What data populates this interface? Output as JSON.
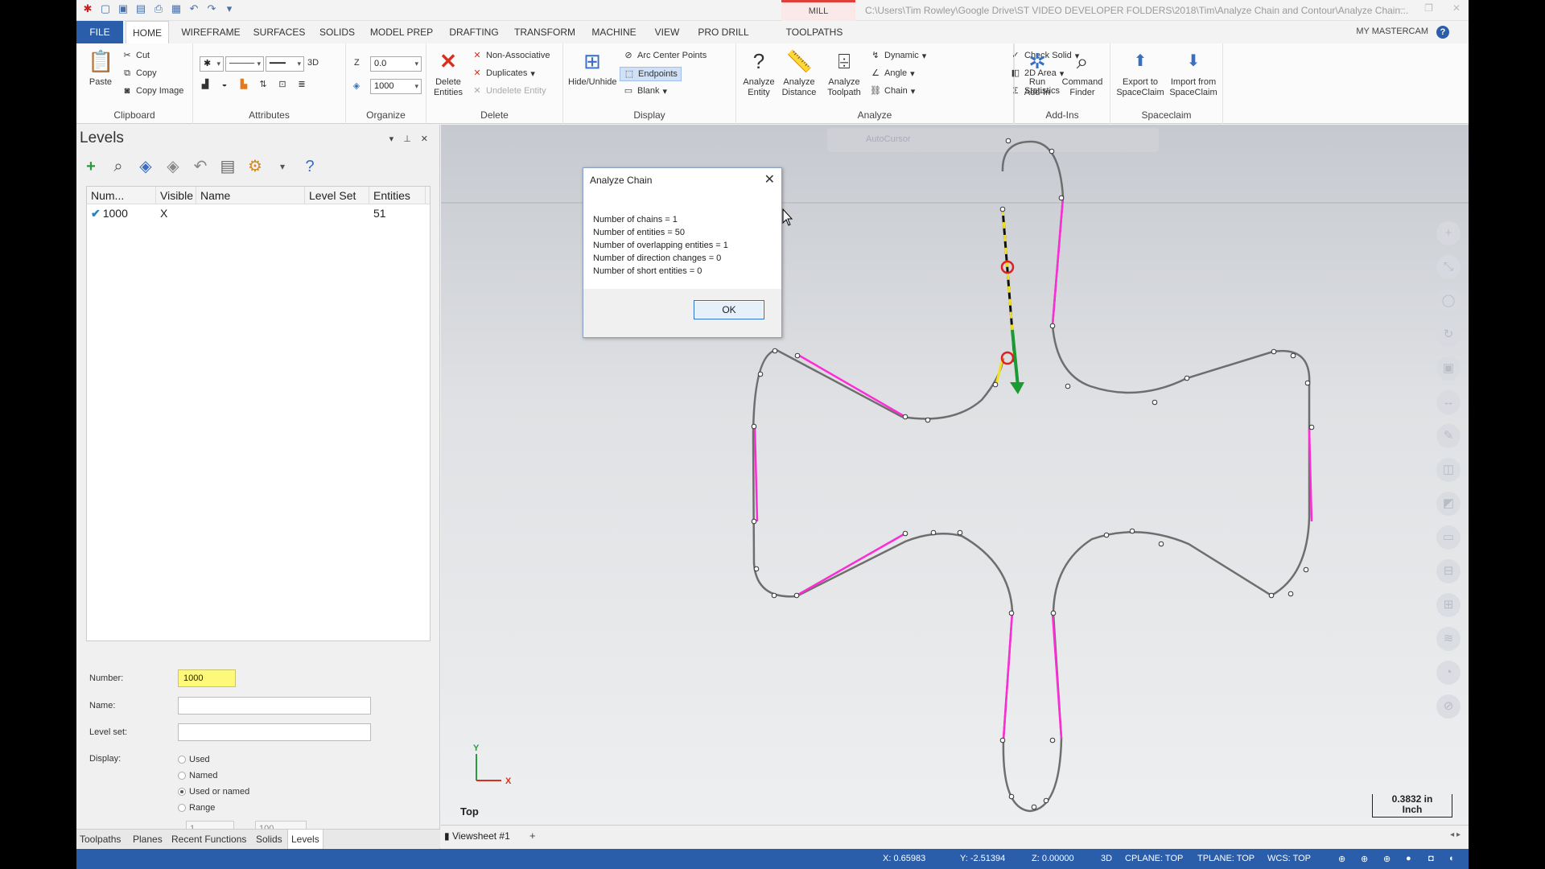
{
  "titlebar": {
    "context_tab": "MILL",
    "window_title": "C:\\Users\\Tim Rowley\\Google Drive\\ST VIDEO DEVELOPER FOLDERS\\2018\\Tim\\Analyze Chain and Contour\\Analyze Chain..."
  },
  "tabs": [
    "FILE",
    "HOME",
    "WIREFRAME",
    "SURFACES",
    "SOLIDS",
    "MODEL PREP",
    "DRAFTING",
    "TRANSFORM",
    "MACHINE",
    "VIEW",
    "PRO DRILL",
    "TOOLPATHS"
  ],
  "my_mastercam": "MY MASTERCAM",
  "ribbon": {
    "clipboard": {
      "label": "Clipboard",
      "paste": "Paste",
      "cut": "Cut",
      "copy": "Copy",
      "copy_image": "Copy Image"
    },
    "attributes": {
      "label": "Attributes",
      "mode_3d": "3D"
    },
    "organize": {
      "label": "Organize",
      "z_label": "Z",
      "z_value": "0.0",
      "level_value": "1000"
    },
    "delete": {
      "label": "Delete",
      "delete_entities": "Delete Entities",
      "non_associative": "Non-Associative",
      "duplicates": "Duplicates",
      "undelete": "Undelete Entity"
    },
    "display": {
      "label": "Display",
      "hide_unhide": "Hide/Unhide",
      "arc_center": "Arc Center Points",
      "endpoints": "Endpoints",
      "blank": "Blank"
    },
    "analyze": {
      "label": "Analyze",
      "analyze_entity": "Analyze Entity",
      "analyze_distance": "Analyze Distance",
      "analyze_toolpath": "Analyze Toolpath",
      "dynamic": "Dynamic",
      "angle": "Angle",
      "chain": "Chain",
      "check_solid": "Check Solid",
      "area_2d": "2D Area",
      "statistics": "Statistics"
    },
    "addins": {
      "label": "Add-Ins",
      "run_addin": "Run Add-In",
      "command_finder": "Command Finder"
    },
    "spaceclaim": {
      "label": "Spaceclaim",
      "export": "Export to SpaceClaim",
      "import": "Import from SpaceClaim"
    }
  },
  "levels_panel": {
    "title": "Levels",
    "columns": [
      "Num...",
      "Visible",
      "Name",
      "Level Set",
      "Entities"
    ],
    "rows": [
      {
        "number": "1000",
        "visible": "X",
        "name": "",
        "level_set": "",
        "entities": "51"
      }
    ],
    "form": {
      "number_label": "Number:",
      "number_value": "1000",
      "name_label": "Name:",
      "name_value": "",
      "level_set_label": "Level set:",
      "level_set_value": "",
      "display_label": "Display:",
      "options": [
        "Used",
        "Named",
        "Used or named",
        "Range"
      ],
      "selected_option": "Used or named",
      "range_from": "1",
      "range_to": "100"
    },
    "bottom_tabs": [
      "Toolpaths",
      "Planes",
      "Recent Functions",
      "Solids",
      "Levels"
    ]
  },
  "viewport": {
    "view_name": "Top",
    "axis_y": "Y",
    "axis_x": "X",
    "scale_value": "0.3832 in",
    "scale_unit": "Inch",
    "toolbar_autocursor": "AutoCursor",
    "viewsheet_tab": "Viewsheet #1",
    "colors": {
      "gray": "#6e6e6e",
      "magenta": "#ff2bd6",
      "yellow": "#f0e020",
      "green": "#1a9a30",
      "red": "#e02020"
    }
  },
  "dialog": {
    "title": "Analyze Chain",
    "lines": [
      "Number of chains =  1",
      "Number of entities =  50",
      "Number of overlapping entities =  1",
      "Number of direction changes =  0",
      "Number of short entities =  0"
    ],
    "ok": "OK"
  },
  "statusbar": {
    "x": "X:  0.65983",
    "y": "Y:  -2.51394",
    "z": "Z:  0.00000",
    "mode": "3D",
    "cplane": "CPLANE: TOP",
    "tplane": "TPLANE: TOP",
    "wcs": "WCS: TOP"
  }
}
